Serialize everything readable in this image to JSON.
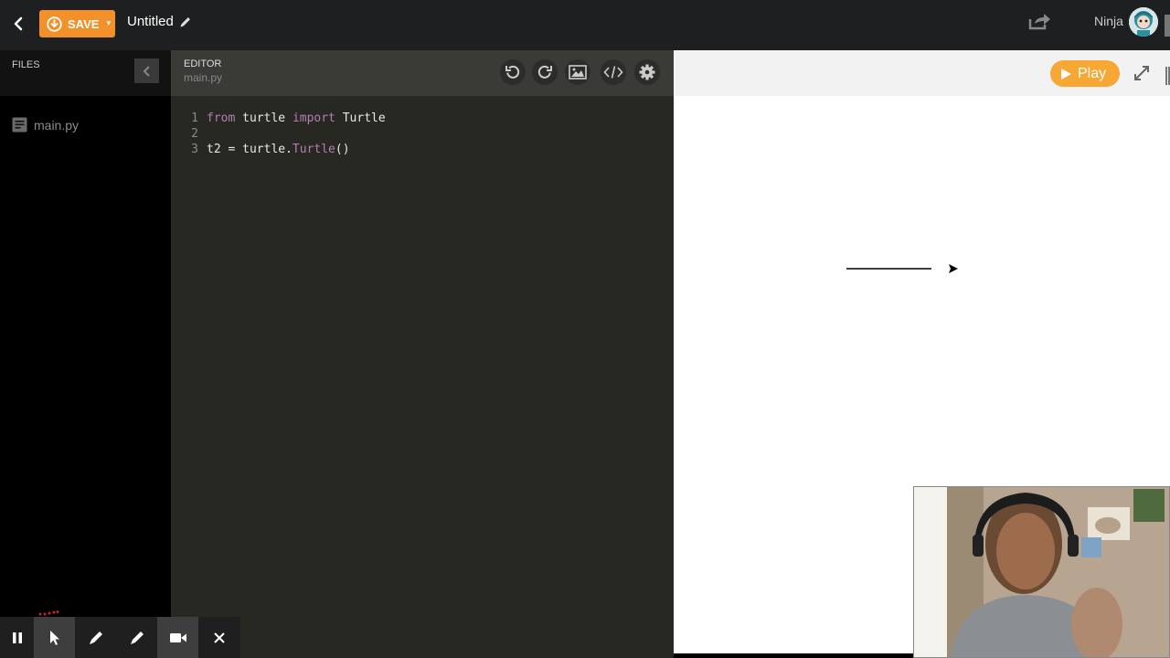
{
  "topbar": {
    "save_label": "SAVE",
    "save_caret": "▾",
    "project_title": "Untitled",
    "username": "Ninja",
    "icons": [
      "back-chevron-icon",
      "save-download-icon",
      "pencil-icon",
      "share-icon",
      "avatar"
    ]
  },
  "files": {
    "header_label": "FILES",
    "items": [
      {
        "name": "main.py",
        "icon": "document-icon"
      }
    ]
  },
  "editor": {
    "header_label": "EDITOR",
    "file_name": "main.py",
    "toolbar_icons": [
      "undo-icon",
      "redo-icon",
      "image-icon",
      "code-icon",
      "settings-gear-icon"
    ],
    "code": [
      {
        "num": "1",
        "tokens": [
          {
            "t": "from",
            "c": "kw"
          },
          {
            "t": " turtle ",
            "c": "tx"
          },
          {
            "t": "import",
            "c": "kw"
          },
          {
            "t": " Turtle",
            "c": "tx"
          }
        ]
      },
      {
        "num": "2",
        "tokens": []
      },
      {
        "num": "3",
        "tokens": [
          {
            "t": "t2 = turtle.",
            "c": "tx"
          },
          {
            "t": "Turtle",
            "c": "fn"
          },
          {
            "t": "()",
            "c": "tx"
          }
        ]
      }
    ]
  },
  "output": {
    "play_label": "Play",
    "icons": [
      "play-triangle-icon",
      "expand-icon"
    ]
  },
  "recorder_toolbar": {
    "buttons": [
      "pause-icon",
      "pointer-cursor-icon",
      "pen-icon",
      "highlighter-icon",
      "camera-icon",
      "close-icon"
    ],
    "active": [
      "pointer-cursor-icon",
      "camera-icon"
    ]
  },
  "colors": {
    "save": "#f2902a",
    "play": "#f7a733",
    "editor_bg": "#272822",
    "keyword": "#b77cb3"
  }
}
